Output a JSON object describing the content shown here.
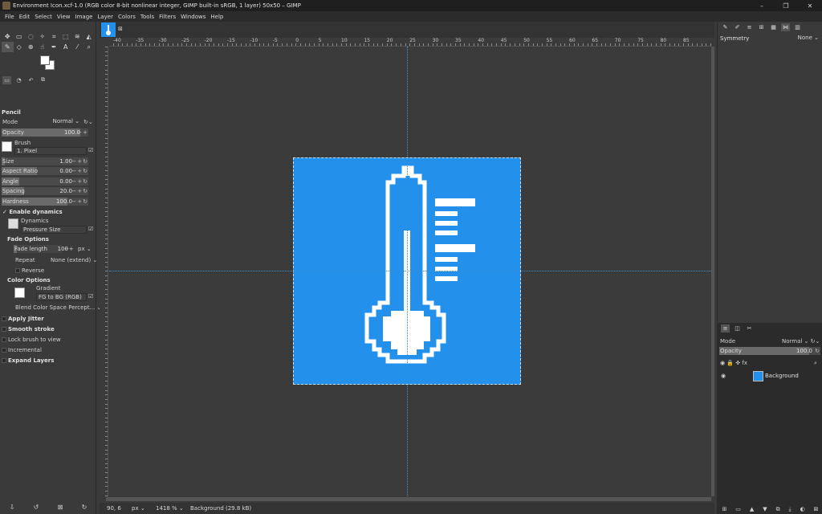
{
  "window": {
    "title": "Environment Icon.xcf-1.0 (RGB color 8-bit nonlinear integer, GIMP built-in sRGB, 1 layer) 50x50 – GIMP",
    "controls": [
      "–",
      "❐",
      "✕"
    ]
  },
  "menu": [
    "File",
    "Edit",
    "Select",
    "View",
    "Image",
    "Layer",
    "Colors",
    "Tools",
    "Filters",
    "Windows",
    "Help"
  ],
  "tool_options": {
    "title": "Pencil",
    "mode_label": "Mode",
    "mode_value": "Normal",
    "opacity_label": "Opacity",
    "opacity_value": "100.0",
    "brush_label": "Brush",
    "brush_value": "1. Pixel",
    "size_label": "Size",
    "size_value": "1.00",
    "aspect_label": "Aspect Ratio",
    "aspect_value": "0.00",
    "angle_label": "Angle",
    "angle_value": "0.00",
    "spacing_label": "Spacing",
    "spacing_value": "20.0",
    "hardness_label": "Hardness",
    "hardness_value": "100.0",
    "enable_dynamics": "Enable dynamics",
    "dynamics_label": "Dynamics",
    "dynamics_value": "Pressure Size",
    "fade_options": "Fade Options",
    "fade_length_label": "Fade length",
    "fade_length_value": "100",
    "fade_unit": "px",
    "repeat_label": "Repeat",
    "repeat_value": "None (extend)",
    "reverse": "Reverse",
    "color_options": "Color Options",
    "gradient_label": "Gradient",
    "gradient_value": "FG to BG (RGB)",
    "blend_space": "Blend Color Space Percept...",
    "apply_jitter": "Apply Jitter",
    "smooth_stroke": "Smooth stroke",
    "lock_brush": "Lock brush to view",
    "incremental": "Incremental",
    "expand_layers": "Expand Layers"
  },
  "ruler_ticks": [
    "-40",
    "-35",
    "-30",
    "-25",
    "-20",
    "-15",
    "-10",
    "-5",
    "0",
    "5",
    "10",
    "15",
    "20",
    "25",
    "30",
    "35",
    "40",
    "45",
    "50",
    "55",
    "60",
    "65",
    "70",
    "75",
    "80",
    "85"
  ],
  "status": {
    "coords": "90, 6",
    "unit": "px",
    "zoom": "1418 %",
    "message": "Background (29.8 kB)"
  },
  "symmetry": {
    "label": "Symmetry",
    "value": "None"
  },
  "layers": {
    "mode_label": "Mode",
    "mode_value": "Normal",
    "opacity_label": "Opacity",
    "opacity_value": "100.0",
    "items": [
      {
        "name": "Background"
      }
    ]
  },
  "colors": {
    "image_bg": "#2391ec",
    "icon_fg": "#ffffff",
    "guide": "#3c8fcb"
  }
}
